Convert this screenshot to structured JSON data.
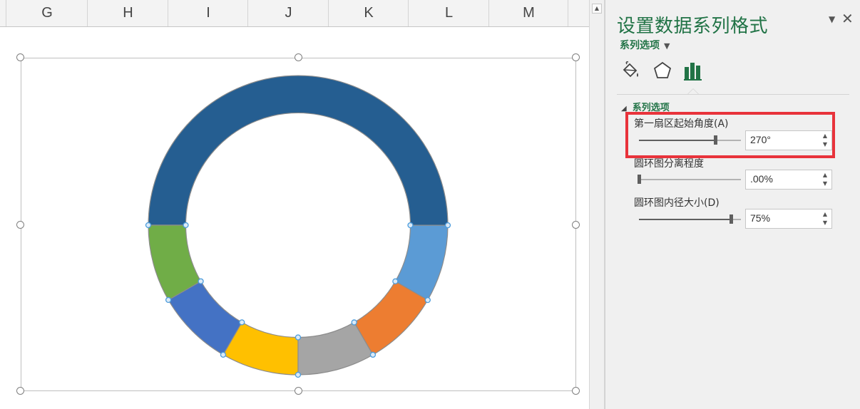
{
  "columns": [
    "G",
    "H",
    "I",
    "J",
    "K",
    "L",
    "M"
  ],
  "colors": {
    "accent": "#217346",
    "highlight": "#e8333b",
    "selection_handle": "#4a9bdc"
  },
  "chart_data": {
    "type": "pie",
    "subtype": "doughnut",
    "first_slice_angle_deg": 270,
    "hole_size_percent": 75,
    "explosion_percent": 0,
    "slices": [
      {
        "value": 50,
        "color": "#255e91"
      },
      {
        "value": 8.33,
        "color": "#5b9bd5"
      },
      {
        "value": 8.33,
        "color": "#ed7d31"
      },
      {
        "value": 8.33,
        "color": "#a5a5a5"
      },
      {
        "value": 8.33,
        "color": "#ffc000"
      },
      {
        "value": 8.33,
        "color": "#4472c4"
      },
      {
        "value": 8.33,
        "color": "#70ad47"
      }
    ],
    "selected_point_range": "top-half segments"
  },
  "pane": {
    "title": "设置数据系列格式",
    "options_menu": "系列选项",
    "tabs": [
      {
        "name": "fill-line",
        "icon": "paint-bucket-icon"
      },
      {
        "name": "effects",
        "icon": "pentagon-icon"
      },
      {
        "name": "series-options",
        "icon": "bar-chart-icon",
        "active": true
      }
    ],
    "section": "系列选项",
    "options": [
      {
        "label": "第一扇区起始角度(A)",
        "value": "270°",
        "level": 0.75
      },
      {
        "label": "圆环图分离程度",
        "value": ".00%",
        "level": 0.0
      },
      {
        "label": "圆环图内径大小(D)",
        "value": "75%",
        "level": 0.9
      }
    ]
  }
}
